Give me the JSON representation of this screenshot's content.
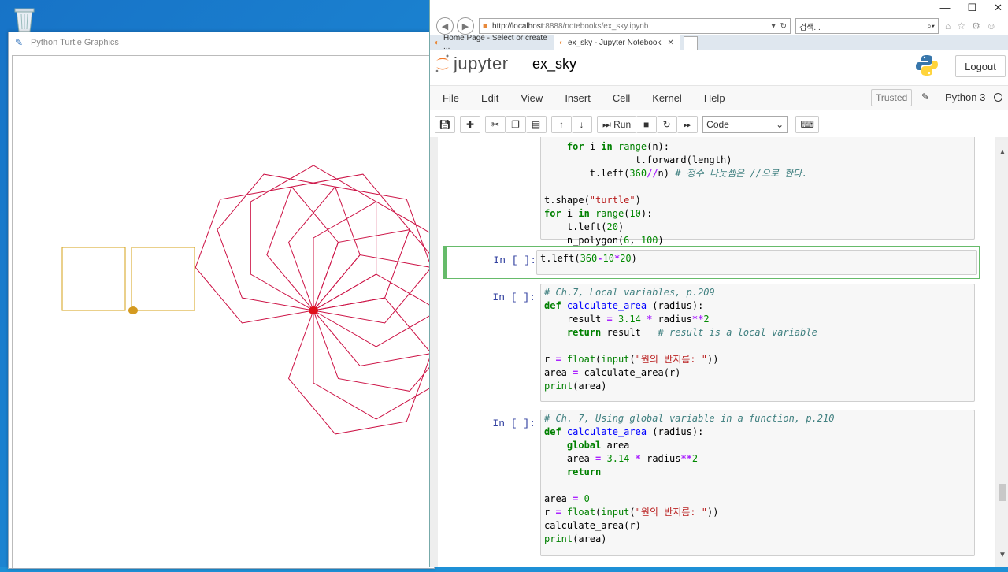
{
  "turtle_window": {
    "title": "Python Turtle Graphics",
    "colors": {
      "square_color": "#d4a017",
      "polygon_color": "#cc1144",
      "turtle_color_1": "#d49a20",
      "turtle_color_2": "#e0101a"
    }
  },
  "browser": {
    "address": {
      "host": "http://localhost",
      "path": ":8888/notebooks/ex_sky.ipynb"
    },
    "search_placeholder": "검색...",
    "tabs": [
      {
        "label": "Home Page - Select or create ..."
      },
      {
        "label": "ex_sky - Jupyter Notebook"
      }
    ]
  },
  "jupyter": {
    "logo_text": "jupyter",
    "notebook_name": "ex_sky",
    "logout_label": "Logout",
    "menu": [
      "File",
      "Edit",
      "View",
      "Insert",
      "Cell",
      "Kernel",
      "Help"
    ],
    "trusted_label": "Trusted",
    "kernel_name": "Python 3",
    "toolbar": {
      "run_label": "Run",
      "cell_type": "Code"
    }
  },
  "cells": [
    {
      "prompt": "",
      "lines_text": [
        "        t.forward(length)",
        "        t.left(360//n) # 정수 나눗셈은 //으로 한다.",
        "",
        "t.shape(\"turtle\")",
        "for i in range(10):",
        "    t.left(20)",
        "    n_polygon(6, 100)"
      ]
    },
    {
      "prompt": "In [ ]:",
      "lines_text": [
        "t.left(360-10*20)"
      ]
    },
    {
      "prompt": "In [ ]:",
      "lines_text": [
        "# Ch.7, Local variables, p.209",
        "def calculate_area (radius):",
        "    result = 3.14 * radius**2",
        "    return result   # result is a local variable",
        "",
        "r = float(input(\"원의 반지름: \"))",
        "area = calculate_area(r)",
        "print(area)"
      ]
    },
    {
      "prompt": "In [ ]:",
      "lines_text": [
        "# Ch. 7, Using global variable in a function, p.210",
        "def calculate_area (radius):",
        "    global area",
        "    area = 3.14 * radius**2",
        "    return",
        "",
        "area = 0",
        "r = float(input(\"원의 반지름: \"))",
        "calculate_area(r)",
        "print(area)"
      ]
    }
  ]
}
